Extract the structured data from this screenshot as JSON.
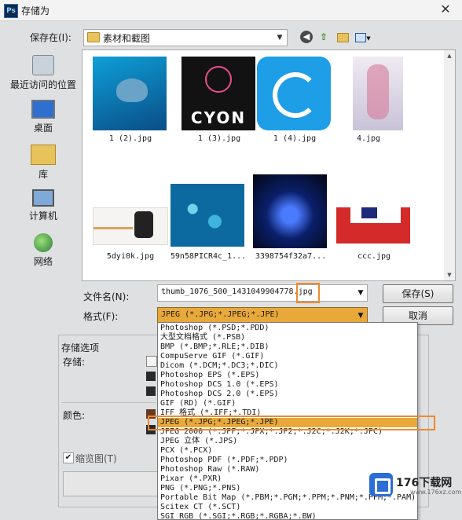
{
  "window": {
    "title": "存储为",
    "app_icon": "Ps"
  },
  "location": {
    "label": "保存在(I):",
    "current_folder": "素材和截图"
  },
  "toolbar": {
    "back_icon": "back-arrow-icon",
    "up_icon": "up-folder-icon",
    "new_folder_icon": "new-folder-icon",
    "views_icon": "views-menu-icon"
  },
  "sidebar": {
    "items": [
      {
        "label": "最近访问的位置",
        "icon": "recent-places-icon"
      },
      {
        "label": "桌面",
        "icon": "desktop-icon"
      },
      {
        "label": "库",
        "icon": "library-icon"
      },
      {
        "label": "计算机",
        "icon": "computer-icon"
      },
      {
        "label": "网络",
        "icon": "network-icon"
      }
    ]
  },
  "files": [
    {
      "name": "1 (2).jpg"
    },
    {
      "name": "1 (3).jpg",
      "logo_text": "CYON"
    },
    {
      "name": "1 (4).jpg"
    },
    {
      "name": "4.jpg"
    },
    {
      "name": "5dyi0k.jpg"
    },
    {
      "name": "59n58PICR4c_1..."
    },
    {
      "name": "3398754f32a7..."
    },
    {
      "name": "ccc.jpg"
    }
  ],
  "filename": {
    "label": "文件名(N):",
    "value": "thumb_1076_500_1431049904778.jpg"
  },
  "format": {
    "label": "格式(F):",
    "selected": "JPEG (*.JPG;*.JPEG;*.JPE)",
    "options": [
      "Photoshop (*.PSD;*.PDD)",
      "大型文档格式 (*.PSB)",
      "BMP (*.BMP;*.RLE;*.DIB)",
      "CompuServe GIF (*.GIF)",
      "Dicom (*.DCM;*.DC3;*.DIC)",
      "Photoshop EPS (*.EPS)",
      "Photoshop DCS 1.0 (*.EPS)",
      "Photoshop DCS 2.0 (*.EPS)",
      "GIF (RD) (*.GIF)",
      "IFF 格式 (*.IFF;*.TDI)",
      "JPEG (*.JPG;*.JPEG;*.JPE)",
      "JPEG 2000 (*.JPF;*.JPX;*.JP2;*.J2C;*.J2K;*.JPC)",
      "JPEG 立体 (*.JPS)",
      "PCX (*.PCX)",
      "Photoshop PDF (*.PDF;*.PDP)",
      "Photoshop Raw (*.RAW)",
      "Pixar (*.PXR)",
      "PNG (*.PNG;*.PNS)",
      "Portable Bit Map (*.PBM;*.PGM;*.PPM;*.PNM;*.PFM;*.PAM)",
      "Scitex CT (*.SCT)",
      "SGI RGB (*.SGI;*.RGB;*.RGBA;*.BW)"
    ]
  },
  "buttons": {
    "save": "保存(S)",
    "cancel": "取消"
  },
  "options": {
    "title": "存储选项",
    "storage_label": "存储:",
    "color_label": "颜色:",
    "thumbnail_label": "缩览图(T)"
  },
  "watermark": {
    "text": "176下载网",
    "url": "www.176xz.com"
  },
  "colors": {
    "highlight": "#e9a93a",
    "annotation_outline": "#f0892a",
    "dialog_bg": "#dfe0e2"
  }
}
